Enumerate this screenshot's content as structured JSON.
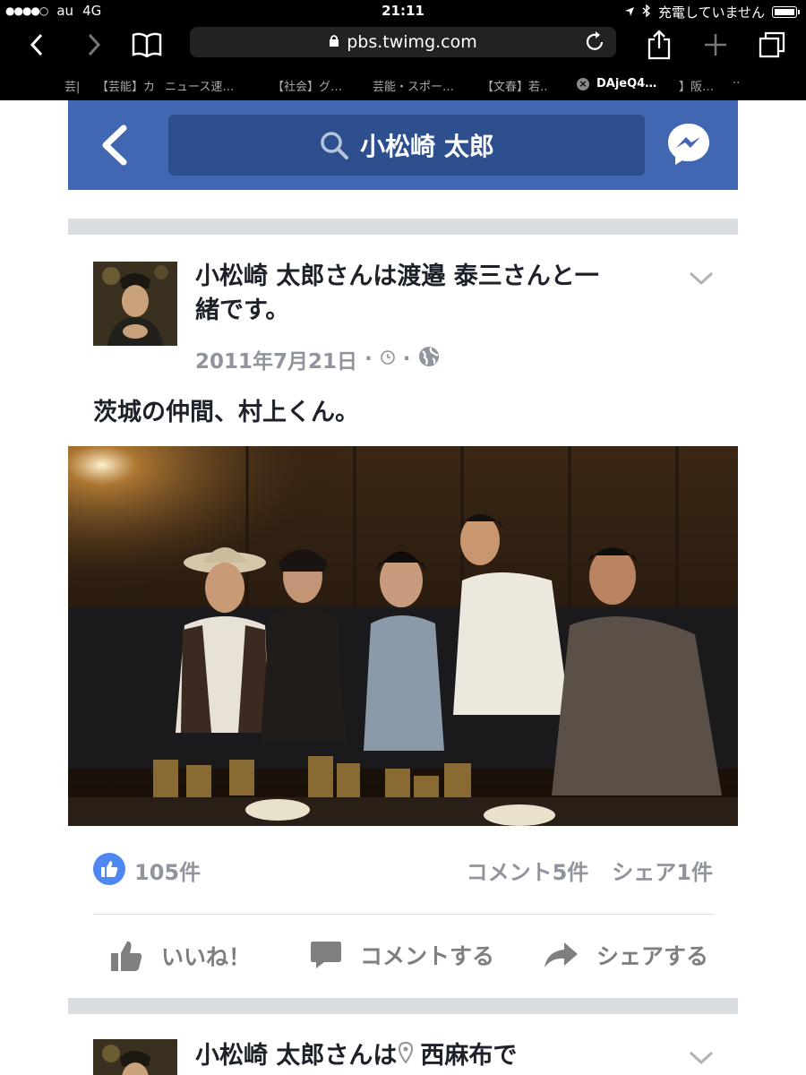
{
  "status_bar": {
    "carrier": "au",
    "network": "4G",
    "time": "21:11",
    "charging_text": "充電していません"
  },
  "browser": {
    "url": "pbs.twimg.com",
    "tabs": [
      {
        "label": "芸|",
        "active": false
      },
      {
        "label": "【芸能】カ",
        "active": false
      },
      {
        "label": "ニュース速…",
        "active": false
      },
      {
        "label": "【社会】グ…",
        "active": false
      },
      {
        "label": "芸能・スポー…",
        "active": false
      },
      {
        "label": "【文春】若…",
        "active": false
      },
      {
        "label": "DAjeQ4…",
        "active": true
      },
      {
        "label": "】阪…",
        "active": false
      },
      {
        "label": "··",
        "active": false
      }
    ]
  },
  "header": {
    "search_text": "小松崎 太郎",
    "header_color": "#4267b2"
  },
  "post": {
    "title": "小松崎 太郎さんは渡邉 泰三さんと一",
    "title_line2": "緒です。",
    "date": "2011年7月21日",
    "meta_sep": "·",
    "text": "茨城の仲間、村上くん。",
    "likes": "105件",
    "comments": "コメント5件",
    "shares": "シェア1件",
    "like_action": "いいね！",
    "comment_action": "コメントする",
    "share_action": "シェアする"
  },
  "next_post": {
    "title_prefix": "小松崎 太郎さんは",
    "location": "西麻布で"
  },
  "icons": {
    "back": "chevron-left-icon",
    "search": "search-icon",
    "messenger": "messenger-icon",
    "globe": "globe-icon",
    "clock": "clock-icon",
    "like": "thumbs-up-icon"
  }
}
